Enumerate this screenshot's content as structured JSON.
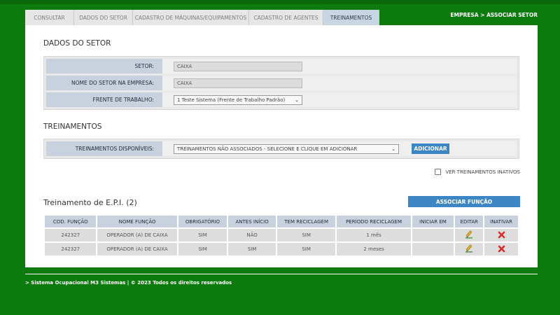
{
  "tabs": [
    {
      "label": "CONSULTAR",
      "active": false
    },
    {
      "label": "DADOS DO SETOR",
      "active": false
    },
    {
      "label": "CADASTRO DE MÁQUINAS/EQUIPAMENTOS",
      "active": false
    },
    {
      "label": "CADASTRO DE AGENTES",
      "active": false
    },
    {
      "label": "TREINAMENTOS",
      "active": true
    }
  ],
  "breadcrumb": "EMPRESA > ASSOCIAR SETOR",
  "dados_setor": {
    "title": "DADOS DO SETOR",
    "setor_label": "SETOR:",
    "setor_value": "CAIXA",
    "nome_label": "NOME DO SETOR NA EMPRESA:",
    "nome_value": "CAIXA",
    "frente_label": "FRENTE DE TRABALHO:",
    "frente_value": "1 Teste Sistema (Frente de Trabalho Padrão)"
  },
  "treinamentos": {
    "title": "TREINAMENTOS",
    "disponiveis_label": "TREINAMENTOS DISPONÍVEIS:",
    "disponiveis_value": "TREINAMENTOS NÃO ASSOCIADOS - SELECIONE E CLIQUE EM ADICIONAR",
    "adicionar_label": "ADICIONAR",
    "inativos_label": "VER TREINAMENTOS INATIVOS",
    "inativos_checked": false
  },
  "epi": {
    "title": "Treinamento de E.P.I. (2)",
    "associar_label": "ASSOCIAR FUNÇÃO",
    "columns": [
      "COD. FUNÇÃO",
      "NOME FUNÇÃO",
      "OBRIGATÓRIO",
      "ANTES INÍCIO",
      "TEM RECICLAGEM",
      "PERÍODO RECICLAGEM",
      "INICIAR EM",
      "EDITAR",
      "INATIVAR"
    ],
    "rows": [
      {
        "cod": "242327",
        "nome": "OPERADOR (A) DE CAIXA",
        "obrigatorio": "SIM",
        "antes": "NÃO",
        "reciclagem": "SIM",
        "periodo": "1 mês",
        "iniciar": ""
      },
      {
        "cod": "242327",
        "nome": "OPERADOR (A) DE CAIXA",
        "obrigatorio": "SIM",
        "antes": "SIM",
        "reciclagem": "SIM",
        "periodo": "2 meses",
        "iniciar": ""
      }
    ]
  },
  "footer": "> Sistema Ocupacional M3 Sistemas | © 2023 Todos os direitos reservados",
  "colors": {
    "background": "#0d7a0d",
    "accent": "#3d86c6",
    "label_bg": "#c8d2de",
    "delete": "#d62b2b"
  },
  "icons": {
    "edit": "pencil-edit-icon",
    "inactivate": "red-x-icon",
    "dropdown": "chevron-down-icon"
  }
}
